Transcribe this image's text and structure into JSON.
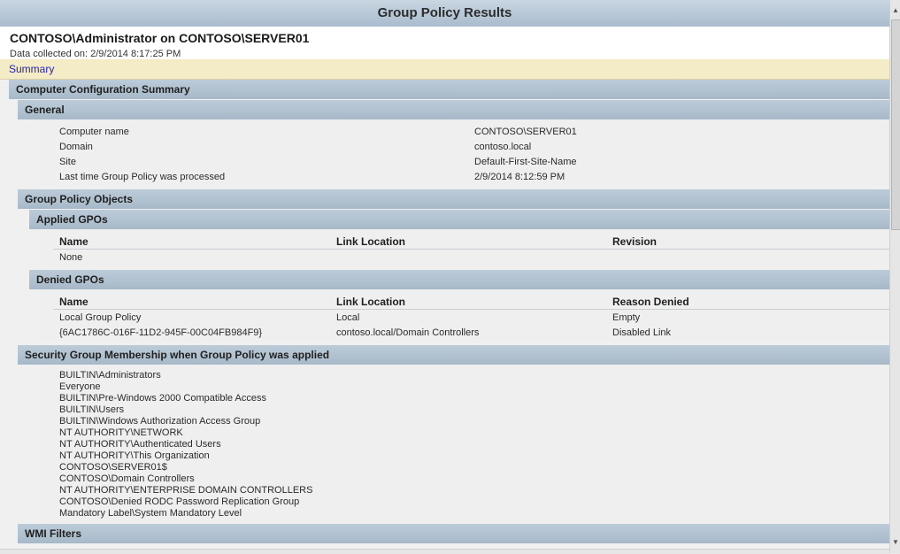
{
  "window": {
    "title": "Group Policy Results"
  },
  "report": {
    "heading": "CONTOSO\\Administrator on CONTOSO\\SERVER01",
    "collected": "Data collected on: 2/9/2014 8:17:25 PM",
    "summary_link": "Summary"
  },
  "computer_config": {
    "title": "Computer Configuration Summary"
  },
  "general": {
    "title": "General",
    "rows": [
      {
        "label": "Computer name",
        "value": "CONTOSO\\SERVER01"
      },
      {
        "label": "Domain",
        "value": "contoso.local"
      },
      {
        "label": "Site",
        "value": "Default-First-Site-Name"
      },
      {
        "label": "Last time Group Policy was processed",
        "value": "2/9/2014 8:12:59 PM"
      }
    ]
  },
  "gpo": {
    "title": "Group Policy Objects",
    "applied": {
      "title": "Applied GPOs",
      "headers": [
        "Name",
        "Link Location",
        "Revision"
      ],
      "rows": [
        [
          "None",
          "",
          ""
        ]
      ]
    },
    "denied": {
      "title": "Denied GPOs",
      "headers": [
        "Name",
        "Link Location",
        "Reason Denied"
      ],
      "rows": [
        [
          "Local Group Policy",
          "Local",
          "Empty"
        ],
        [
          "{6AC1786C-016F-11D2-945F-00C04FB984F9}",
          "contoso.local/Domain Controllers",
          "Disabled Link"
        ]
      ]
    }
  },
  "security": {
    "title": "Security Group Membership when Group Policy was applied",
    "groups": [
      "BUILTIN\\Administrators",
      "Everyone",
      "BUILTIN\\Pre-Windows 2000 Compatible Access",
      "BUILTIN\\Users",
      "BUILTIN\\Windows Authorization Access Group",
      "NT AUTHORITY\\NETWORK",
      "NT AUTHORITY\\Authenticated Users",
      "NT AUTHORITY\\This Organization",
      "CONTOSO\\SERVER01$",
      "CONTOSO\\Domain Controllers",
      "NT AUTHORITY\\ENTERPRISE DOMAIN CONTROLLERS",
      "CONTOSO\\Denied RODC Password Replication Group",
      "Mandatory Label\\System Mandatory Level"
    ]
  },
  "wmi": {
    "title": "WMI Filters"
  },
  "scrollbar": {
    "up_icon": "arrow-up-icon",
    "down_icon": "arrow-down-icon"
  }
}
